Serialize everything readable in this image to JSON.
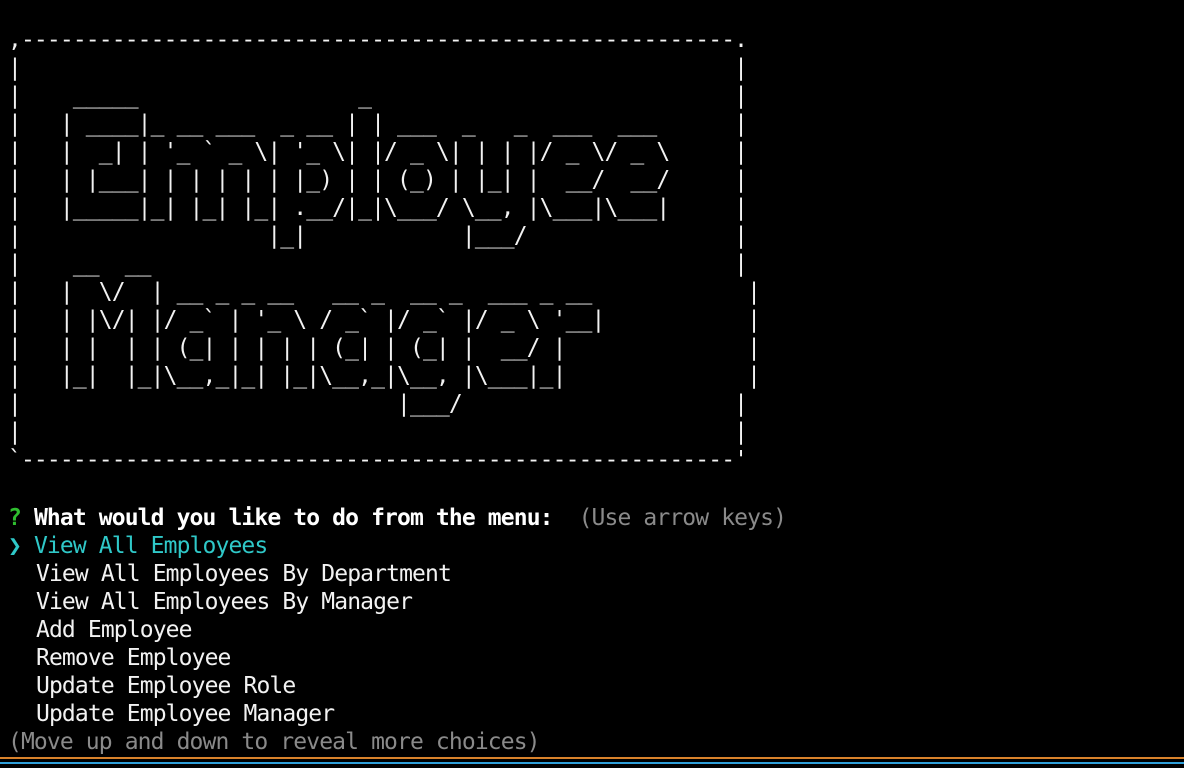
{
  "banner": {
    "ascii_art": ",-------------------------------------------------------.\n|                                                       |\n|    _____                 _                            |\n|   | ____|_ __ ___  _ __ | | ___  _   _  ___  ___      |\n|   |  _| | '_ ` _ \\| '_ \\| |/ _ \\| | | |/ _ \\/ _ \\     |\n|   | |___| | | | | | |_) | | (_) | |_| |  __/  __/     |\n|   |_____|_| |_| |_| .__/|_|\\___/ \\__, |\\___|\\___|     |\n|                   |_|            |___/                |\n|    __  __                                             |\n|   |  \\/  | __ _ _ __   __ _  __ _  ___ _ __            |\n|   | |\\/| |/ _` | '_ \\ / _` |/ _` |/ _ \\ '__|           |\n|   | |  | | (_| | | | | (_| | (_| |  __/ |              |\n|   |_|  |_|\\__,_|_| |_|\\__,_|\\__, |\\___|_|              |\n|                             |___/                     |\n|                                                       |\n`-------------------------------------------------------'"
  },
  "prompt": {
    "qmark": "?",
    "question": "What would you like to do from the menu:",
    "hint": "(Use arrow keys)",
    "pointer": "❯",
    "choices": [
      "View All Employees",
      "View All Employees By Department",
      "View All Employees By Manager",
      "Add Employee",
      "Remove Employee",
      "Update Employee Role",
      "Update Employee Manager"
    ],
    "selected_index": 0,
    "footer": "(Move up and down to reveal more choices)"
  },
  "colors": {
    "background": "#000000",
    "text": "#f2f2f2",
    "qmark": "#2fbf2f",
    "selected": "#2fc8c8",
    "hint": "#8a8a8a",
    "bar_orange": "#d9822b",
    "bar_blue": "#2f9fd9"
  }
}
